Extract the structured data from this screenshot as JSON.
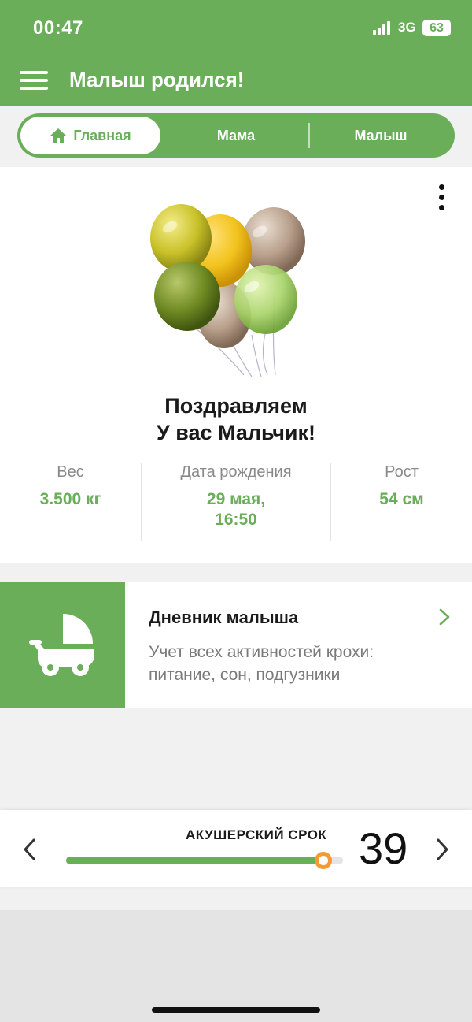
{
  "status_bar": {
    "time": "00:47",
    "network": "3G",
    "battery": "63"
  },
  "header": {
    "title": "Малыш родился!",
    "menu_icon": "hamburger-menu-icon"
  },
  "tabs": [
    {
      "label": "Главная",
      "icon": "home-icon",
      "active": true
    },
    {
      "label": "Мама",
      "active": false
    },
    {
      "label": "Малыш",
      "active": false
    }
  ],
  "main": {
    "image": "balloons-illustration",
    "congrats_line1": "Поздравляем",
    "congrats_line2": "У вас Мальчик!",
    "stats": [
      {
        "label": "Вес",
        "value": "3.500 кг"
      },
      {
        "label": "Дата рождения",
        "value_line1": "29 мая,",
        "value_line2": "16:50"
      },
      {
        "label": "Рост",
        "value": "54 см"
      }
    ]
  },
  "diary": {
    "title": "Дневник малыша",
    "description": "Учет всех активностей крохи: питание, сон, подгузники",
    "icon": "baby-stroller-icon"
  },
  "term": {
    "label": "АКУШЕРСКИЙ СРОК",
    "week": "39",
    "progress": 0.93
  },
  "colors": {
    "brand_green": "#6aae5a",
    "knob_orange": "#f39a33"
  }
}
